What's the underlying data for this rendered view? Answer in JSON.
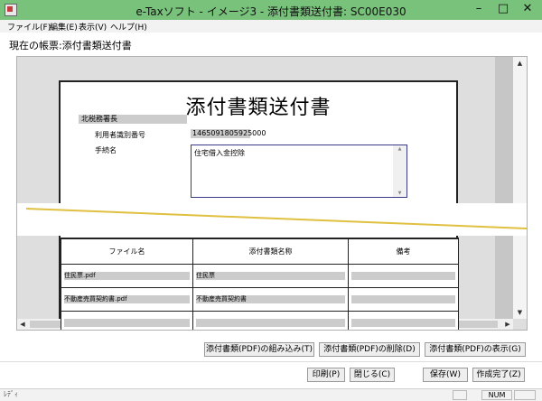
{
  "window": {
    "title": "e-Taxソフト - イメージ3 - 添付書類送付書: SC00E030",
    "minimize": "–",
    "maximize": "□",
    "close": "✕"
  },
  "menu": [
    "ファイル(F)",
    "編集(E)",
    "表示(V)",
    "ヘルプ(H)"
  ],
  "current_form": "現在の帳票:添付書類送付書",
  "document": {
    "title": "添付書類送付書",
    "tax_office": "北税務署長",
    "user_id_label": "利用者識別番号",
    "user_id_value": "1465091805925000",
    "procedure_label": "手続名",
    "procedure_value": "住宅借入金控除"
  },
  "table": {
    "headers": [
      "ファイル名",
      "添付書類名称",
      "備考"
    ],
    "rows": [
      {
        "file": "住民票.pdf",
        "name": "住民票",
        "note": ""
      },
      {
        "file": "不動産売買契約書.pdf",
        "name": "不動産売買契約書",
        "note": ""
      },
      {
        "file": "",
        "name": "",
        "note": ""
      }
    ]
  },
  "scroll": {
    "up": "▲",
    "down": "▼",
    "left": "◀",
    "right": "▶"
  },
  "buttons": {
    "attach": "添付書類(PDF)の組み込み(T)",
    "delete": "添付書類(PDF)の削除(D)",
    "show": "添付書類(PDF)の表示(G)",
    "print": "印刷(P)",
    "close": "閉じる(C)",
    "save": "保存(W)",
    "done": "作成完了(Z)"
  },
  "status": {
    "left": "ﾚﾃﾞｨ",
    "panel1": "",
    "num": "NUM",
    "panel3": ""
  },
  "colors": {
    "titlebar": "#79c27c",
    "break_line": "#e0c040",
    "field_gray": "#cccccc"
  }
}
